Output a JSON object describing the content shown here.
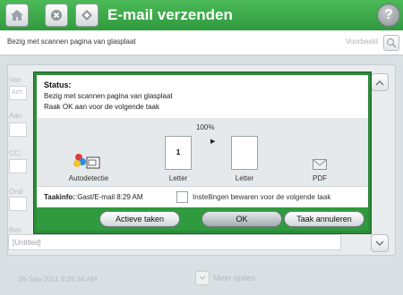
{
  "topbar": {
    "title": "E-mail verzenden",
    "buttons": [
      "home-icon",
      "stop-icon",
      "start-icon"
    ],
    "help_label": "?"
  },
  "statusbar": {
    "message": "Bezig met scannen pagina van glasplaat",
    "preview_label": "Voorbeeld"
  },
  "background_form": {
    "labels": [
      "Van",
      "Aan",
      "CC:",
      "Ond",
      "Bes"
    ],
    "field_stubs": [
      "Ach"
    ],
    "untitled_value": "[Untitled]"
  },
  "footer": {
    "timestamp": "26-Sep-2011 8:29:34 AM",
    "more_options": "Meer opties"
  },
  "dialog": {
    "status_title": "Status:",
    "line1": "Bezig met scannen pagina van glasplaat",
    "line2": "Raak OK aan voor de volgende taak",
    "progress_percent": "100%",
    "source_label": "Autodetectie",
    "page_count": "1",
    "letter1": "Letter",
    "letter2": "Letter",
    "format": "PDF",
    "info_label": "Taakinfo:",
    "info_value": ":Gast/E-mail 8:29 AM",
    "checkbox_label": "Instellingen bewaren voor de volgende taak",
    "buttons": {
      "active_jobs": "Actieve taken",
      "ok": "OK",
      "cancel_job": "Taak annuleren"
    }
  },
  "colors": {
    "accent_green": "#2f9a3e",
    "dialog_border": "#2e8b3a"
  }
}
